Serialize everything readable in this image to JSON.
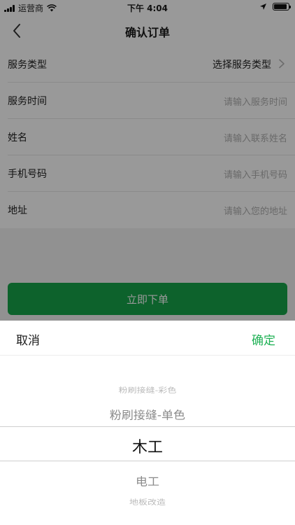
{
  "status_bar": {
    "carrier": "运营商",
    "time": "下午 4:04",
    "battery_level": 0.92
  },
  "nav": {
    "title": "确认订单"
  },
  "form": {
    "rows": [
      {
        "label": "服务类型",
        "value": "选择服务类型"
      },
      {
        "label": "服务时间",
        "placeholder": "请输入服务时间"
      },
      {
        "label": "姓名",
        "placeholder": "请输入联系姓名"
      },
      {
        "label": "手机号码",
        "placeholder": "请输入手机号码"
      },
      {
        "label": "地址",
        "placeholder": "请输入您的地址"
      }
    ]
  },
  "submit": {
    "label": "立即下单"
  },
  "picker_sheet": {
    "cancel_label": "取消",
    "confirm_label": "确定",
    "options": [
      "粉刷接缝-彩色",
      "粉刷接缝-单色",
      "木工",
      "电工",
      "地板改造"
    ],
    "selected_index": 2
  },
  "colors": {
    "accent": "#16a34a",
    "confirm": "#1fb155",
    "overlay": "rgba(0,0,0,0.4)"
  }
}
